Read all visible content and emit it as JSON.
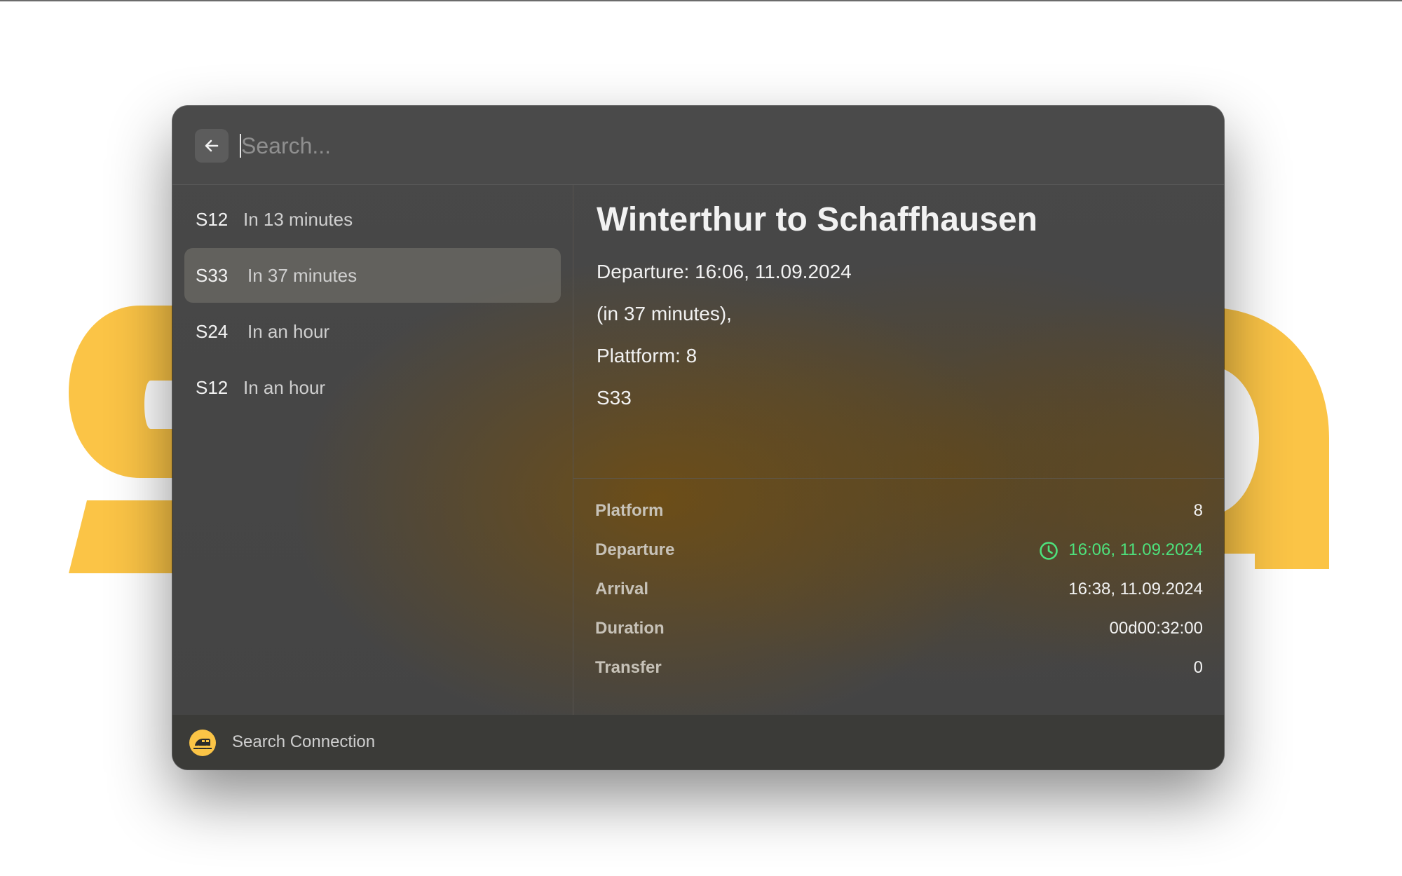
{
  "app": {
    "brand_color": "#FBC446",
    "accent_color": "#4EE17C"
  },
  "search": {
    "placeholder": "Search...",
    "value": ""
  },
  "connections": [
    {
      "line": "S12",
      "eta": "In 13 minutes",
      "selected": false
    },
    {
      "line": "S33",
      "eta": "In 37 minutes",
      "selected": true
    },
    {
      "line": "S24",
      "eta": "In an hour",
      "selected": false
    },
    {
      "line": "S12",
      "eta": "In an hour",
      "selected": false
    }
  ],
  "detail": {
    "title": "Winterthur to Schaffhausen",
    "departure_line": "Departure: 16:06,  11.09.2024",
    "relative_line": "(in 37 minutes),",
    "platform_line": "Plattform: 8",
    "train_line": "S33"
  },
  "metadata": [
    {
      "label": "Platform",
      "value": "8",
      "icon": "",
      "color": ""
    },
    {
      "label": "Departure",
      "value": "16:06,  11.09.2024",
      "icon": "clock-icon",
      "color": "#4EE17C"
    },
    {
      "label": "Arrival",
      "value": "16:38,  11.09.2024",
      "icon": "",
      "color": ""
    },
    {
      "label": "Duration",
      "value": "00d00:32:00",
      "icon": "",
      "color": ""
    },
    {
      "label": "Transfer",
      "value": "0",
      "icon": "",
      "color": ""
    }
  ],
  "footer": {
    "icon": "train-logo-icon",
    "action_label": "Search Connection"
  }
}
